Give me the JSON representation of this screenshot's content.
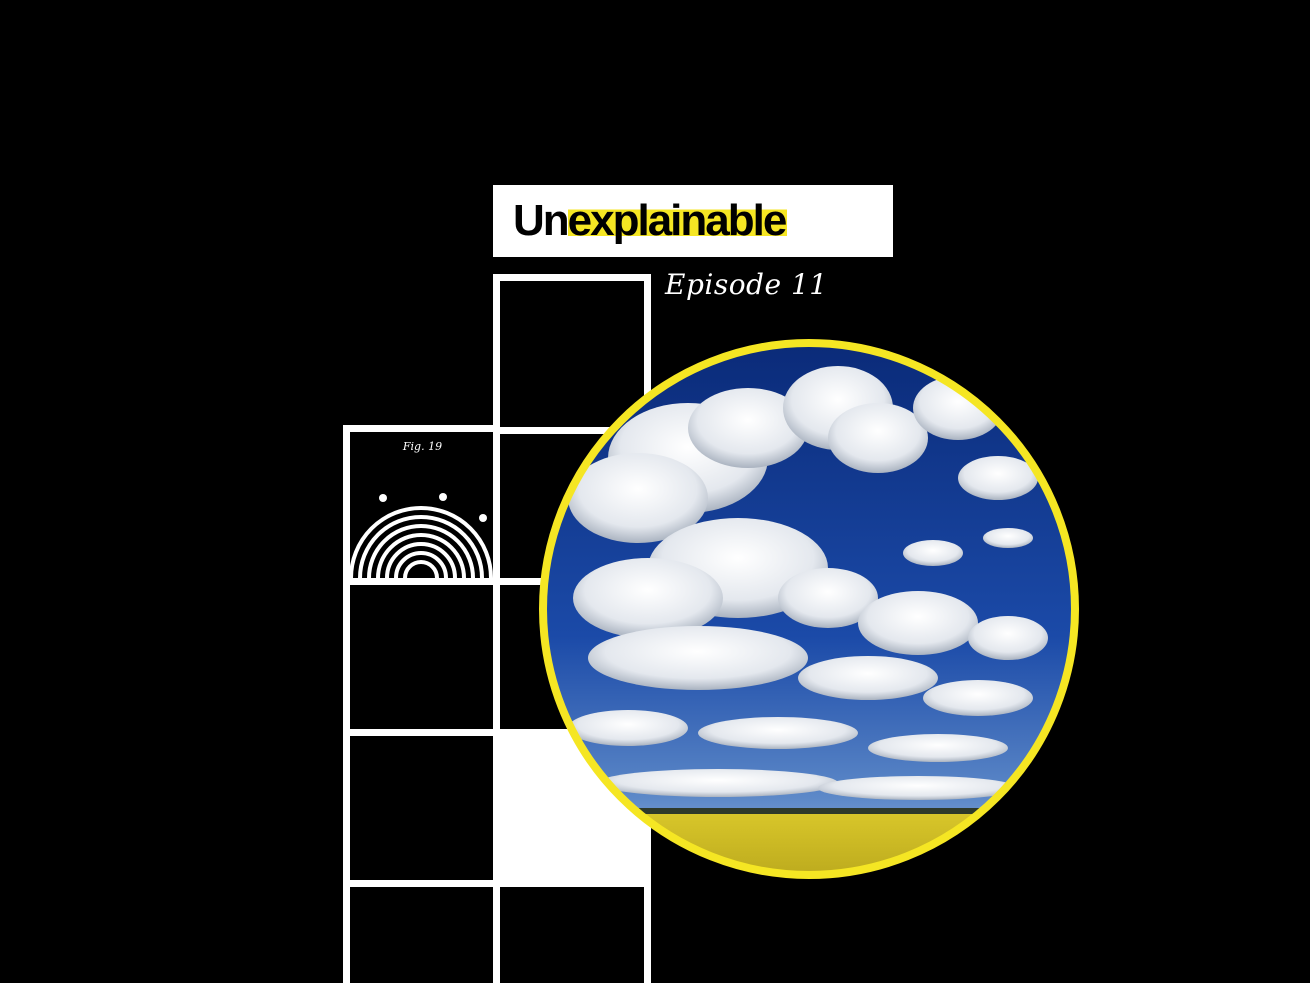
{
  "logo": {
    "prefix": "Un",
    "highlight": "explainable"
  },
  "episode_label": "Episode 11",
  "figure": {
    "label": "Fig. 19"
  },
  "colors": {
    "background": "#000000",
    "accent_yellow": "#f5e623",
    "line_white": "#ffffff",
    "sky_blue": "#0b2f86",
    "field_yellow": "#e3d22a"
  },
  "image": {
    "subject": "cloudy blue sky over yellow rapeseed field"
  }
}
